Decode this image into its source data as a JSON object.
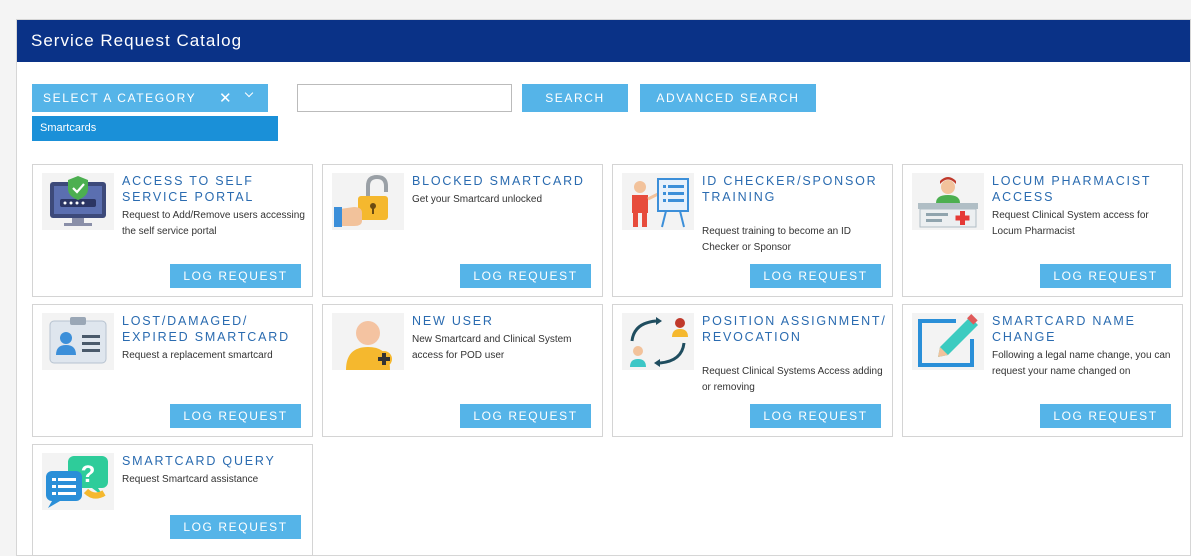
{
  "header": {
    "title": "Service Request Catalog"
  },
  "toolbar": {
    "category_label": "SELECT A CATEGORY",
    "clear_glyph": "✕",
    "selected_category": "Smartcards",
    "search_value": "",
    "search_label": "SEARCH",
    "advanced_label": "ADVANCED SEARCH"
  },
  "cards": [
    {
      "title": "ACCESS TO SELF SERVICE PORTAL",
      "desc": "Request to Add/Remove users accessing the self service portal",
      "button": "LOG REQUEST",
      "icon": "secure-monitor-icon"
    },
    {
      "title": "BLOCKED SMARTCARD",
      "desc": "Get your Smartcard unlocked",
      "button": "LOG REQUEST",
      "icon": "padlock-icon"
    },
    {
      "title": "ID CHECKER/SPONSOR TRAINING",
      "desc": "Request training to become an ID Checker or Sponsor",
      "button": "LOG REQUEST",
      "icon": "training-presenter-icon"
    },
    {
      "title": "LOCUM PHARMACIST ACCESS",
      "desc": "Request Clinical System access for Locum Pharmacist",
      "button": "LOG REQUEST",
      "icon": "pharmacist-icon"
    },
    {
      "title": "LOST/DAMAGED/ EXPIRED SMARTCARD",
      "desc": "Request a replacement smartcard",
      "button": "LOG REQUEST",
      "icon": "id-card-icon"
    },
    {
      "title": "NEW USER",
      "desc": "New Smartcard and Clinical System access for POD user",
      "button": "LOG REQUEST",
      "icon": "add-user-icon"
    },
    {
      "title": "POSITION ASSIGNMENT/ REVOCATION",
      "desc": "Request Clinical Systems Access adding or removing",
      "button": "LOG REQUEST",
      "icon": "swap-users-icon"
    },
    {
      "title": "SMARTCARD NAME CHANGE",
      "desc": "Following a legal name change, you can request your name changed on",
      "button": "LOG REQUEST",
      "icon": "edit-pencil-icon"
    },
    {
      "title": "SMARTCARD QUERY",
      "desc": "Request Smartcard assistance",
      "button": "LOG REQUEST",
      "icon": "question-chat-icon"
    }
  ],
  "colors": {
    "header_bg": "#0a3287",
    "button_bg": "#55b4e8",
    "tag_bg": "#1a90d8",
    "title_text": "#2a6bb0"
  }
}
